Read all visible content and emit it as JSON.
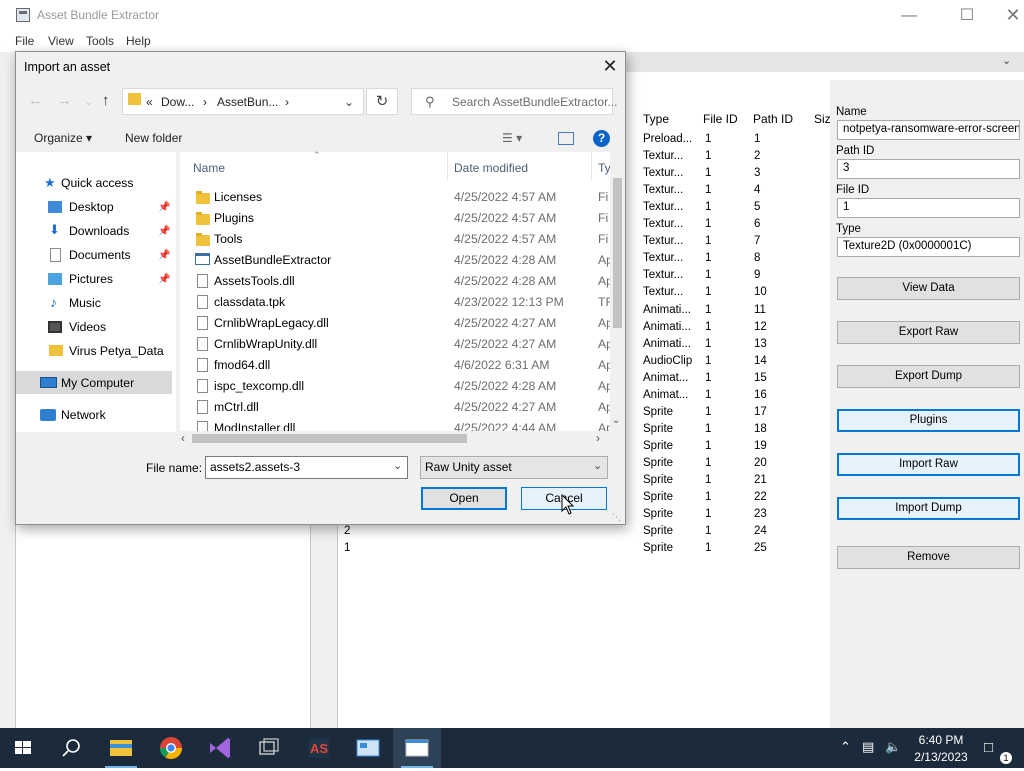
{
  "app": {
    "title": "Asset Bundle Extractor",
    "menu": [
      "File",
      "View",
      "Tools",
      "Help"
    ]
  },
  "table": {
    "headers": [
      "Type",
      "File ID",
      "Path ID",
      "Siz"
    ],
    "rows": [
      {
        "type": "Preload...",
        "file_id": "1",
        "path_id": "1"
      },
      {
        "type": "Textur...",
        "file_id": "1",
        "path_id": "2"
      },
      {
        "type": "Textur...",
        "file_id": "1",
        "path_id": "3"
      },
      {
        "type": "Textur...",
        "file_id": "1",
        "path_id": "4"
      },
      {
        "type": "Textur...",
        "file_id": "1",
        "path_id": "5"
      },
      {
        "type": "Textur...",
        "file_id": "1",
        "path_id": "6"
      },
      {
        "type": "Textur...",
        "file_id": "1",
        "path_id": "7"
      },
      {
        "type": "Textur...",
        "file_id": "1",
        "path_id": "8"
      },
      {
        "type": "Textur...",
        "file_id": "1",
        "path_id": "9"
      },
      {
        "type": "Textur...",
        "file_id": "1",
        "path_id": "10"
      },
      {
        "type": "Animati...",
        "file_id": "1",
        "path_id": "11"
      },
      {
        "type": "Animati...",
        "file_id": "1",
        "path_id": "12"
      },
      {
        "type": "Animati...",
        "file_id": "1",
        "path_id": "13"
      },
      {
        "type": "AudioClip",
        "file_id": "1",
        "path_id": "14"
      },
      {
        "type": "Animat...",
        "file_id": "1",
        "path_id": "15"
      },
      {
        "type": "Animat...",
        "file_id": "1",
        "path_id": "16"
      },
      {
        "type": "Sprite",
        "file_id": "1",
        "path_id": "17"
      },
      {
        "type": "Sprite",
        "file_id": "1",
        "path_id": "18"
      },
      {
        "type": "Sprite",
        "file_id": "1",
        "path_id": "19"
      },
      {
        "type": "Sprite",
        "file_id": "1",
        "path_id": "20"
      },
      {
        "type": "Sprite",
        "file_id": "1",
        "path_id": "21"
      },
      {
        "type": "Sprite",
        "file_id": "1",
        "path_id": "22"
      },
      {
        "type": "Sprite",
        "file_id": "1",
        "path_id": "23"
      },
      {
        "type": "Sprite",
        "file_id": "1",
        "path_id": "24"
      },
      {
        "type": "Sprite",
        "file_id": "1",
        "path_id": "25"
      }
    ],
    "left_values": [
      "2",
      "1"
    ]
  },
  "details": {
    "name_label": "Name",
    "name_value": "notpetya-ransomware-error-screen",
    "path_id_label": "Path ID",
    "path_id_value": "3",
    "file_id_label": "File ID",
    "file_id_value": "1",
    "type_label": "Type",
    "type_value": "Texture2D (0x0000001C)",
    "buttons": [
      "View Data",
      "Export Raw",
      "Export Dump",
      "Plugins",
      "Import Raw",
      "Import Dump",
      "Remove"
    ]
  },
  "dialog": {
    "title": "Import an asset",
    "breadcrumb": [
      "«",
      "Dow...",
      "›",
      "AssetBun...",
      "›"
    ],
    "search_placeholder": "Search AssetBundleExtractor...",
    "organize_label": "Organize ▾",
    "new_folder_label": "New folder",
    "nav": {
      "quick_access": "Quick access",
      "items": [
        "Desktop",
        "Downloads",
        "Documents",
        "Pictures",
        "Music",
        "Videos",
        "Virus Petya_Data"
      ],
      "my_computer": "My Computer",
      "network": "Network"
    },
    "columns": [
      "Name",
      "Date modified",
      "Ty"
    ],
    "files": [
      {
        "name": "Licenses",
        "date": "4/25/2022 4:57 AM",
        "type": "Fi",
        "icon": "folder"
      },
      {
        "name": "Plugins",
        "date": "4/25/2022 4:57 AM",
        "type": "Fi",
        "icon": "folder"
      },
      {
        "name": "Tools",
        "date": "4/25/2022 4:57 AM",
        "type": "Fi",
        "icon": "folder"
      },
      {
        "name": "AssetBundleExtractor",
        "date": "4/25/2022 4:28 AM",
        "type": "Ap",
        "icon": "app"
      },
      {
        "name": "AssetsTools.dll",
        "date": "4/25/2022 4:28 AM",
        "type": "Ap",
        "icon": "file"
      },
      {
        "name": "classdata.tpk",
        "date": "4/23/2022 12:13 PM",
        "type": "TF",
        "icon": "file"
      },
      {
        "name": "CrnlibWrapLegacy.dll",
        "date": "4/25/2022 4:27 AM",
        "type": "Ap",
        "icon": "file"
      },
      {
        "name": "CrnlibWrapUnity.dll",
        "date": "4/25/2022 4:27 AM",
        "type": "Ap",
        "icon": "file"
      },
      {
        "name": "fmod64.dll",
        "date": "4/6/2022 6:31 AM",
        "type": "Ap",
        "icon": "file"
      },
      {
        "name": "ispc_texcomp.dll",
        "date": "4/25/2022 4:28 AM",
        "type": "Ap",
        "icon": "file"
      },
      {
        "name": "mCtrl.dll",
        "date": "4/25/2022 4:27 AM",
        "type": "Ap",
        "icon": "file"
      },
      {
        "name": "ModInstaller.dll",
        "date": "4/25/2022 4:44 AM",
        "type": "Ap",
        "icon": "file"
      }
    ],
    "file_name_label": "File name:",
    "file_name_value": "assets2.assets-3",
    "file_type_value": "Raw Unity asset",
    "open_label": "Open",
    "cancel_label": "Cancel"
  },
  "taskbar": {
    "time": "6:40 PM",
    "date": "2/13/2023",
    "notification_count": "1",
    "colors": {
      "background": "#1c2b3b",
      "accent": "#0078d7"
    }
  }
}
